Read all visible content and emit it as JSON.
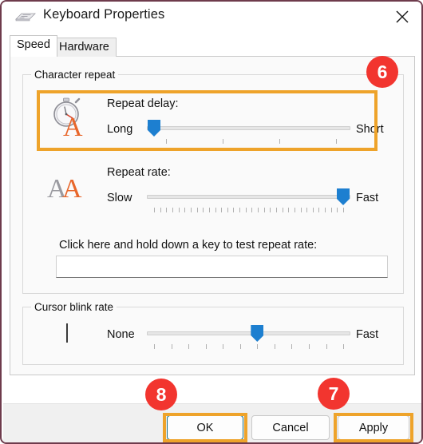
{
  "window": {
    "title": "Keyboard Properties",
    "icon": "keyboard-icon",
    "close_label": "✕"
  },
  "tabs": [
    {
      "label": "Speed",
      "active": true
    },
    {
      "label": "Hardware",
      "active": false
    }
  ],
  "groups": {
    "character_repeat": {
      "label": "Character repeat"
    },
    "cursor_blink_rate": {
      "label": "Cursor blink rate"
    }
  },
  "settings": {
    "repeat_delay": {
      "title": "Repeat delay:",
      "min_label": "Long",
      "max_label": "Short",
      "icon": "stopwatch-a-icon",
      "value": 0,
      "min": 0,
      "max": 3,
      "ticks": 4
    },
    "repeat_rate": {
      "title": "Repeat rate:",
      "min_label": "Slow",
      "max_label": "Fast",
      "icon": "double-a-icon",
      "value": 31,
      "min": 0,
      "max": 31,
      "ticks": 32
    },
    "cursor_blink": {
      "min_label": "None",
      "max_label": "Fast",
      "icon": "text-caret-icon",
      "caret_glyph": "|",
      "value": 6,
      "min": 0,
      "max": 11,
      "ticks": 12
    }
  },
  "test_area": {
    "label": "Click here and hold down a key to test repeat rate:",
    "value": "",
    "placeholder": ""
  },
  "footer": {
    "ok_label": "OK",
    "cancel_label": "Cancel",
    "apply_label": "Apply"
  },
  "annotations": {
    "badge_repeat_delay": "6",
    "badge_apply": "7",
    "badge_ok": "8"
  },
  "colors": {
    "highlight": "#eea32a",
    "badge": "#f2352f",
    "slider_thumb": "#1d7fd0",
    "window_border": "#6e3b4c",
    "accent_orange": "#e8662a"
  }
}
